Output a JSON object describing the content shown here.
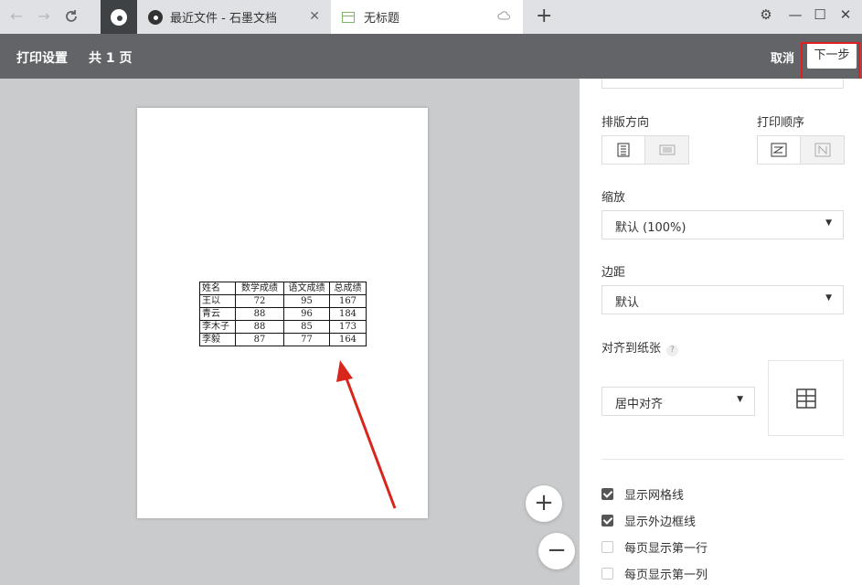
{
  "browser": {
    "tabs": [
      {
        "title": "最近文件 - 石墨文档",
        "close": "✕"
      },
      {
        "title": "无标题"
      }
    ],
    "new_tab": "+",
    "window_controls": {
      "settings": "⚙",
      "minimize": "—",
      "maximize": "☐",
      "close": "✕"
    }
  },
  "print_header": {
    "title": "打印设置",
    "page_count": "共 1 页",
    "cancel_label": "取消",
    "next_label": "下一步"
  },
  "preview": {
    "table": {
      "headers": [
        "姓名",
        "数学成绩",
        "语文成绩",
        "总成绩"
      ],
      "rows": [
        [
          "王以",
          "72",
          "95",
          "167"
        ],
        [
          "青云",
          "88",
          "96",
          "184"
        ],
        [
          "李木子",
          "88",
          "85",
          "173"
        ],
        [
          "李毅",
          "87",
          "77",
          "164"
        ]
      ]
    },
    "zoom_in": "+",
    "zoom_out": "−"
  },
  "panel": {
    "orientation_label": "排版方向",
    "print_order_label": "打印顺序",
    "scale_label": "缩放",
    "scale_value": "默认 (100%)",
    "margin_label": "边距",
    "margin_value": "默认",
    "align_label": "对齐到纸张",
    "align_value": "居中对齐",
    "help": "?",
    "options": [
      {
        "label": "显示网格线",
        "checked": true
      },
      {
        "label": "显示外边框线",
        "checked": true
      },
      {
        "label": "每页显示第一行",
        "checked": false
      },
      {
        "label": "每页显示第一列",
        "checked": false
      }
    ]
  },
  "colors": {
    "header_bg": "#626468",
    "highlight": "#e02020",
    "arrow": "#d9261c"
  }
}
